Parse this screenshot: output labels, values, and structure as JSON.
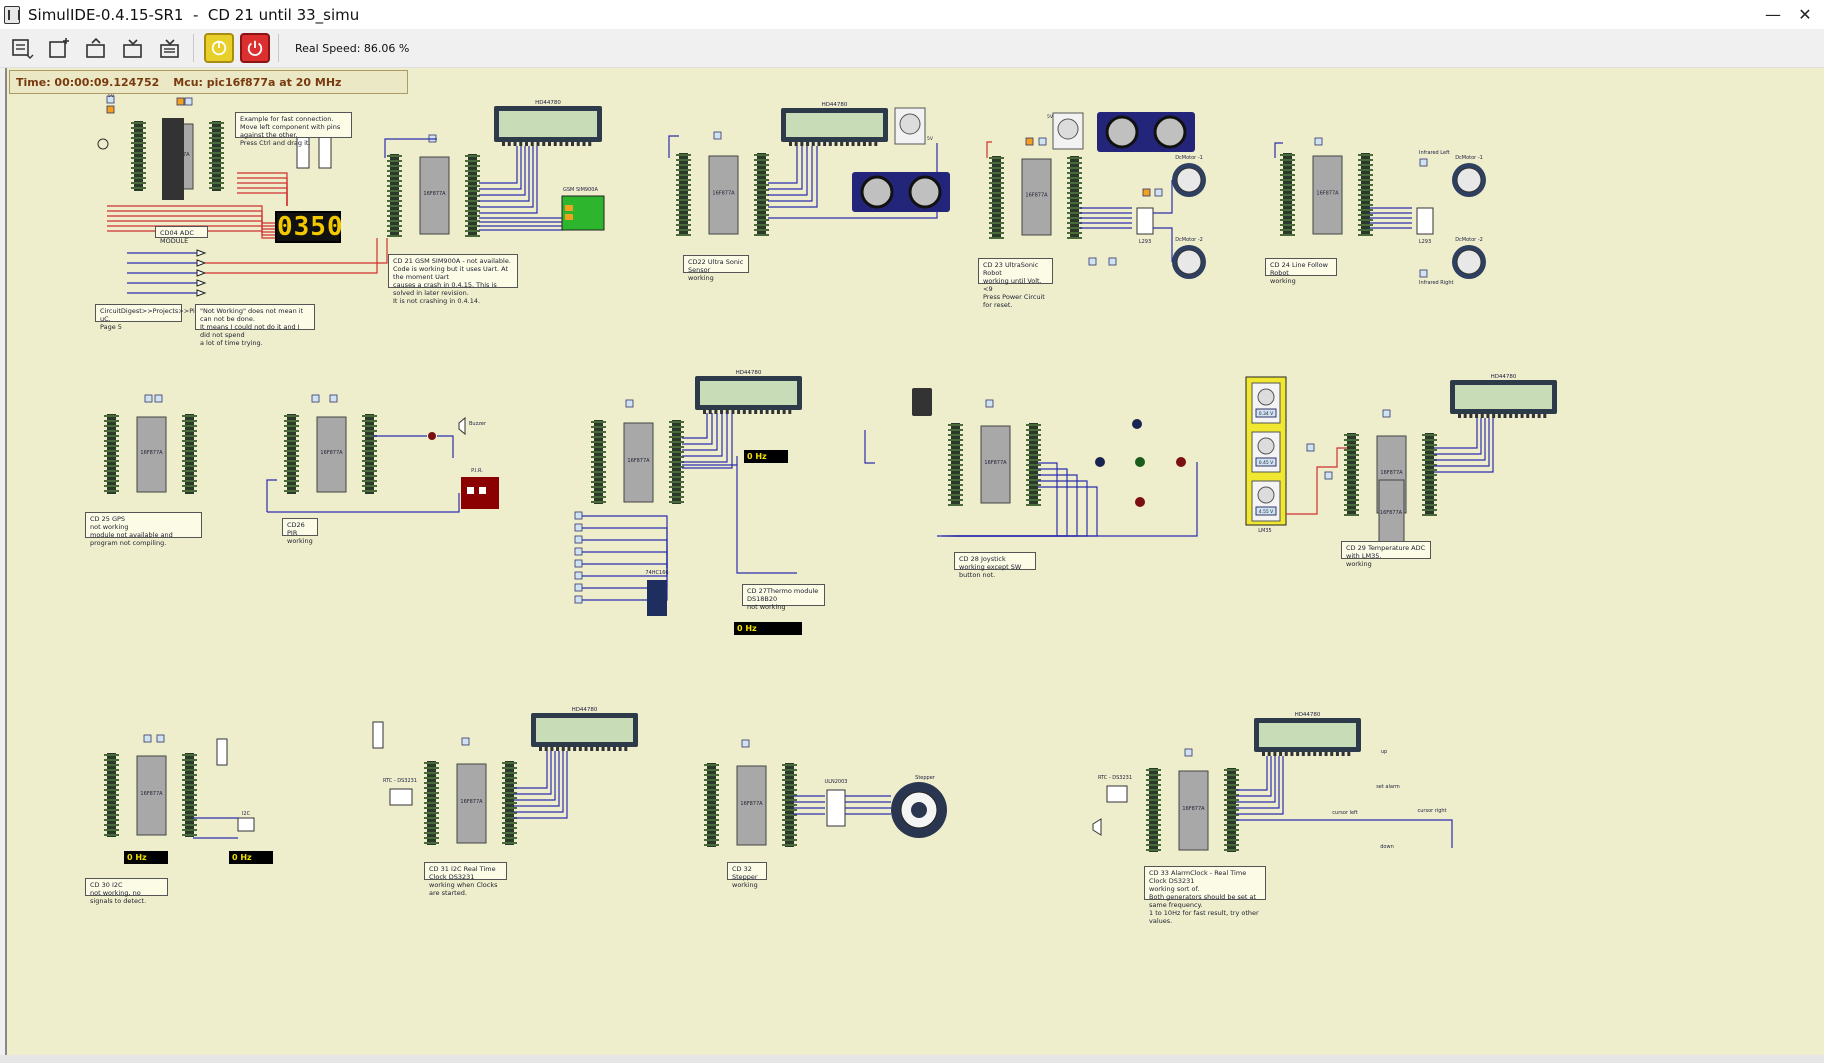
{
  "window": {
    "title": "SimulIDE-0.4.15-SR1  -  CD 21 until 33_simu",
    "minimize_glyph": "—",
    "close_glyph": "✕"
  },
  "toolbar": {
    "icons": [
      "components-menu-icon",
      "new-circuit-icon",
      "open-circuit-icon",
      "save-circuit-icon",
      "save-as-icon",
      "pause-icon",
      "power-icon"
    ],
    "speed_label": "Real Speed: 86.06 %",
    "colors": {
      "pause": "#e8cf2a",
      "power": "#dc2f2f"
    }
  },
  "status": {
    "time": "Time: 00:00:09.124752",
    "mcu": "Mcu: pic16f877a at 20 MHz"
  },
  "canvas": {
    "background": "#eeeecc",
    "wire_color": "#2d2db0",
    "red_wire_color": "#d03030"
  },
  "displays": {
    "seven_segment": "0350",
    "lcd_label": "HD44780",
    "freq_readings": [
      "0 Hz",
      "0 Hz",
      "0 Hz",
      "0 Hz"
    ],
    "pot_readings": [
      "0.34 V",
      "0.45 V",
      "4.55 V"
    ]
  },
  "circuit_labels": {
    "ic": "16F877A",
    "gsm": "GSM SIM900A",
    "l293": "L293",
    "dc_motor_1": "DcMotor -1",
    "dc_motor_2": "DcMotor -2",
    "infrared_left": "Infrared Left",
    "infrared_right": "Infrared Right",
    "buzzer": "Buzzer",
    "pir": "P.I.R.",
    "hc166": "74HC166",
    "lm35": "LM35",
    "rtc": "RTC - DS3231",
    "stepper": "Stepper",
    "uln": "ULN2003",
    "i2c": "I2C",
    "set_alarm": "set alarm",
    "cursor_left": "cursor left",
    "cursor_right": "cursor right",
    "down": "down",
    "up": "up",
    "cd04": "CD04 ADC MODULE"
  },
  "notes": [
    {
      "id": "example",
      "text": "Example for fast connection.\nMove left component with pins against the other.\nPress Ctrl and drag it."
    },
    {
      "id": "cd04-path",
      "text": "CircuitDigest>>Projects>>Pic uC.\nPage 5"
    },
    {
      "id": "not-working",
      "text": "\"Not Working\" does not mean it can not be done.\nIt means I could not do it and I did not spend\na lot of time trying."
    },
    {
      "id": "cd21",
      "text": "CD 21 GSM SIM900A  - not available.\nCode is working but it uses Uart. At the moment Uart\ncauses a crash in 0.4.15. This is solved in later revision.\nIt is not crashing in 0.4.14."
    },
    {
      "id": "cd22",
      "text": "CD22  Ultra Sonic Sensor\nworking"
    },
    {
      "id": "cd23",
      "text": "CD 23  UltraSonic Robot\nworking until Volt. <9\nPress Power Circuit for reset."
    },
    {
      "id": "cd24",
      "text": "CD 24  Line Follow Robot\nworking"
    },
    {
      "id": "cd25",
      "text": "CD 25  GPS\nnot working\nmodule not available and program not compiling."
    },
    {
      "id": "cd26",
      "text": "CD26  PIR\nworking"
    },
    {
      "id": "cd27",
      "text": "CD 27Thermo module DS18B20\nnot working"
    },
    {
      "id": "cd28",
      "text": "CD 28  Joystick\nworking except SW button not."
    },
    {
      "id": "cd29",
      "text": "CD 29 Temperature ADC with LM35.\nworking"
    },
    {
      "id": "cd30",
      "text": "CD 30  I2C\nnot working, no signals to detect."
    },
    {
      "id": "cd31",
      "text": "CD 31  I2C Real Time Clock  DS3231\nworking when Clocks are started."
    },
    {
      "id": "cd32",
      "text": "CD 32 Stepper\nworking"
    },
    {
      "id": "cd33",
      "text": "CD 33  AlarmClock - Real Time Clock DS3231\nworking sort of.\nBoth generators should be set at same frequency.\n1 to 10Hz for fast result, try other values."
    }
  ]
}
